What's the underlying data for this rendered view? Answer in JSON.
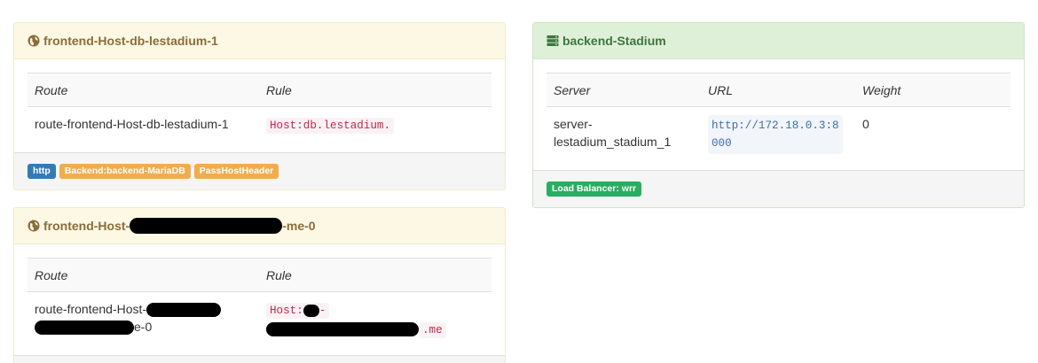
{
  "frontend1": {
    "title": "frontend-Host-db-lestadium-1",
    "icon": "globe-icon",
    "col_route": "Route",
    "col_rule": "Rule",
    "route": "route-frontend-Host-db-lestadium-1",
    "rule": "Host:db.lestadium.",
    "labels": {
      "entrypoint": "http",
      "backend": "Backend:backend-MariaDB",
      "pass": "PassHostHeader"
    }
  },
  "frontend2": {
    "title_prefix": "frontend-Host-",
    "title_suffix": "-me-0",
    "icon": "globe-icon",
    "col_route": "Route",
    "col_rule": "Rule",
    "route_prefix": "route-frontend-Host-",
    "route_suffix": "e-0",
    "rule_prefix": "Host:",
    "rule_dash": "-",
    "rule_suffix": ".me"
  },
  "backend": {
    "title": "backend-Stadium",
    "icon": "server-icon",
    "col_server": "Server",
    "col_url": "URL",
    "col_weight": "Weight",
    "server_line1": "server-",
    "server_line2": "lestadium_stadium_1",
    "url_line1": "http://172.18.0.3:8",
    "url_line2": "000",
    "weight": "0",
    "lb_label": "Load Balancer: wrr"
  },
  "colors": {
    "frontend_heading_bg": "#fcf8e3",
    "frontend_heading_text": "#8a6d3b",
    "backend_heading_bg": "#dff0d8",
    "backend_heading_text": "#3c763d",
    "label_primary": "#337ab7",
    "label_warning": "#f0ad4e",
    "label_success": "#27ae60"
  }
}
